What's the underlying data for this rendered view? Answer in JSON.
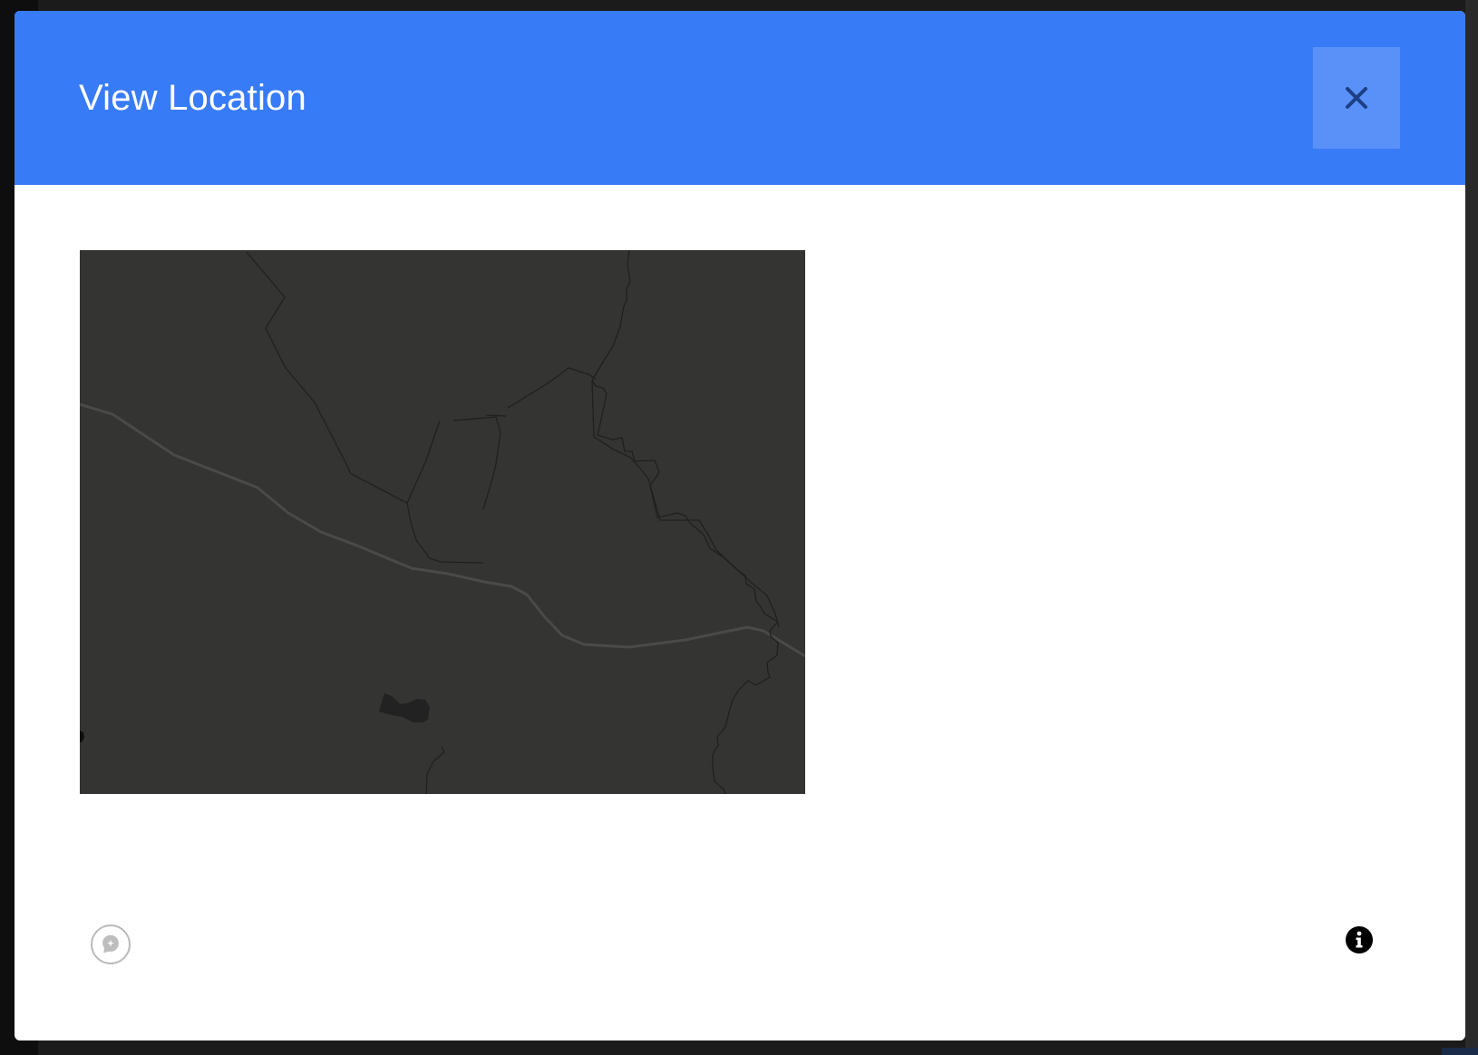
{
  "dialog": {
    "title": "View Location",
    "header_color": "#387bf6",
    "close_icon": "close-icon"
  },
  "map": {
    "theme": "dark",
    "background_color": "#343432"
  },
  "footer": {
    "left_icon": "location-pin-plus-icon",
    "right_icon": "info-icon"
  }
}
